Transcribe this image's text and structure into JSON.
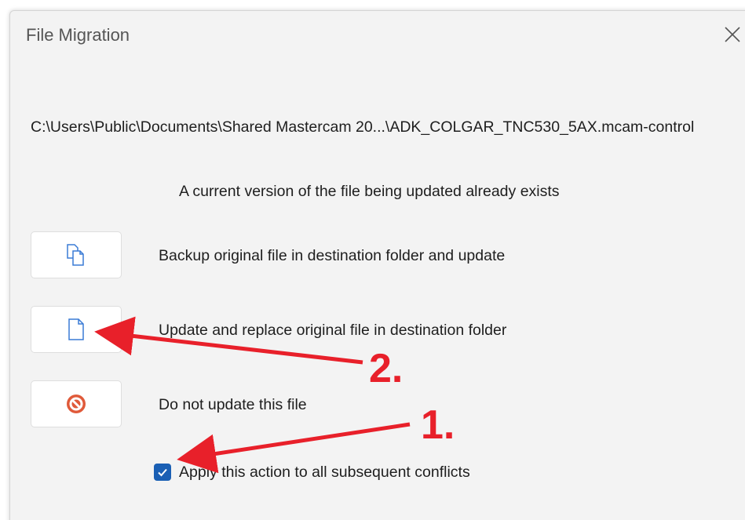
{
  "dialog": {
    "title": "File Migration",
    "close_icon": "close-icon",
    "file_path": "C:\\Users\\Public\\Documents\\Shared Mastercam 20...\\ADK_COLGAR_TNC530_5AX.mcam-control",
    "message": "A current version of the file being updated already exists",
    "options": [
      {
        "icon": "copy-files-icon",
        "label": "Backup original file in destination folder and update"
      },
      {
        "icon": "document-icon",
        "label": "Update and replace original file in destination folder"
      },
      {
        "icon": "prohibited-icon",
        "label": "Do not update this file"
      }
    ],
    "apply_all": {
      "checked": true,
      "label": "Apply this action to all subsequent conflicts"
    }
  },
  "annotations": {
    "label_1": "1.",
    "label_2": "2.",
    "arrow_color": "#e8202a"
  },
  "colors": {
    "accent": "#1a5fb4",
    "icon_blue": "#3a7bd5",
    "stop_red": "#e05a3a"
  }
}
